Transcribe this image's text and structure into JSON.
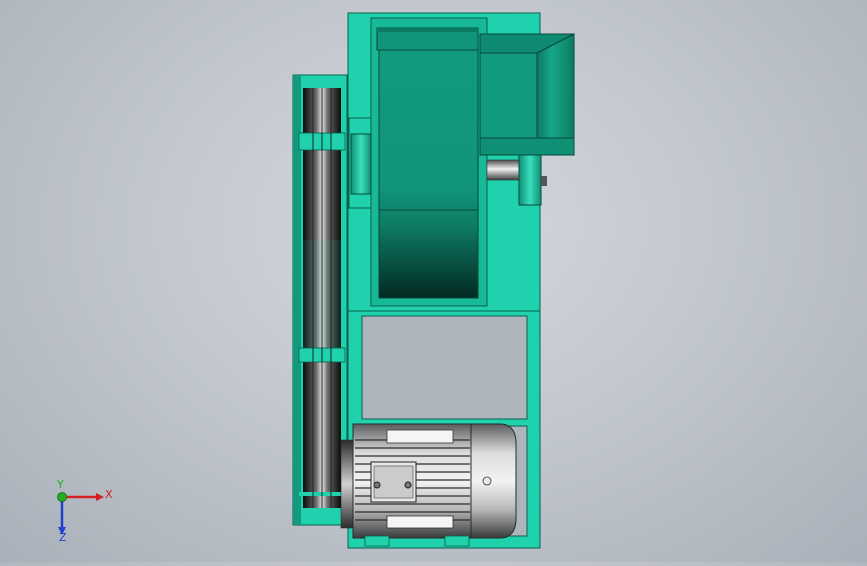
{
  "viewport": {
    "background_top": "#d4d8de",
    "background_bottom": "#aab0b9"
  },
  "model": {
    "body_color": "#1fd1ad",
    "body_dark": "#0e8f74",
    "motor_color": "#c8cacc"
  },
  "triad": {
    "x_label": "X",
    "y_label": "Y",
    "z_label": "Z",
    "x_color": "#d42020",
    "y_color": "#22b022",
    "z_color": "#2040d0"
  }
}
